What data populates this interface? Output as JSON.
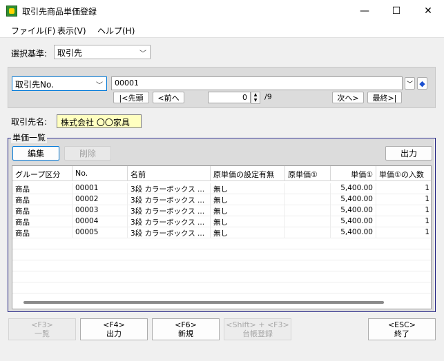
{
  "window": {
    "title": "取引先商品単価登録",
    "minimize": "—",
    "maximize": "☐",
    "close": "✕"
  },
  "menu": [
    "ファイル(F)",
    "表示(V)",
    "ヘルプ(H)"
  ],
  "selection": {
    "label": "選択基準:",
    "value": "取引先"
  },
  "search": {
    "key_field": "取引先No.",
    "value": "00001",
    "first": "|<先頭",
    "prev": "<前へ",
    "page_value": "0",
    "page_total": "/9",
    "next": "次へ>",
    "last": "最終>|"
  },
  "customer": {
    "label": "取引先名:",
    "value": "株式会社 〇〇家具"
  },
  "list": {
    "title": "単価一覧",
    "edit": "編集",
    "delete": "削除",
    "output": "出力",
    "columns": [
      "グループ区分",
      "No.",
      "名前",
      "原単価の設定有無",
      "原単価①",
      "単価①",
      "単価①の入数"
    ],
    "rows": [
      [
        "商品",
        "00001",
        "3段 カラーボックス ...",
        "無し",
        "",
        "5,400.00",
        "1"
      ],
      [
        "商品",
        "00002",
        "3段 カラーボックス ...",
        "無し",
        "",
        "5,400.00",
        "1"
      ],
      [
        "商品",
        "00003",
        "3段 カラーボックス ...",
        "無し",
        "",
        "5,400.00",
        "1"
      ],
      [
        "商品",
        "00004",
        "3段 カラーボックス ...",
        "無し",
        "",
        "5,400.00",
        "1"
      ],
      [
        "商品",
        "00005",
        "3段 カラーボックス ...",
        "無し",
        "",
        "5,400.00",
        "1"
      ]
    ]
  },
  "fkeys": [
    {
      "key": "<F3>",
      "label": "一覧"
    },
    {
      "key": "<F4>",
      "label": "出力"
    },
    {
      "key": "<F6>",
      "label": "新規"
    },
    {
      "key": "<Shift> + <F3>",
      "label": "台帳登録"
    },
    {
      "key": "<ESC>",
      "label": "終了"
    }
  ],
  "colors": {
    "accent": "#0078d7",
    "highlight": "#ffffc0",
    "group_border": "#202080"
  }
}
